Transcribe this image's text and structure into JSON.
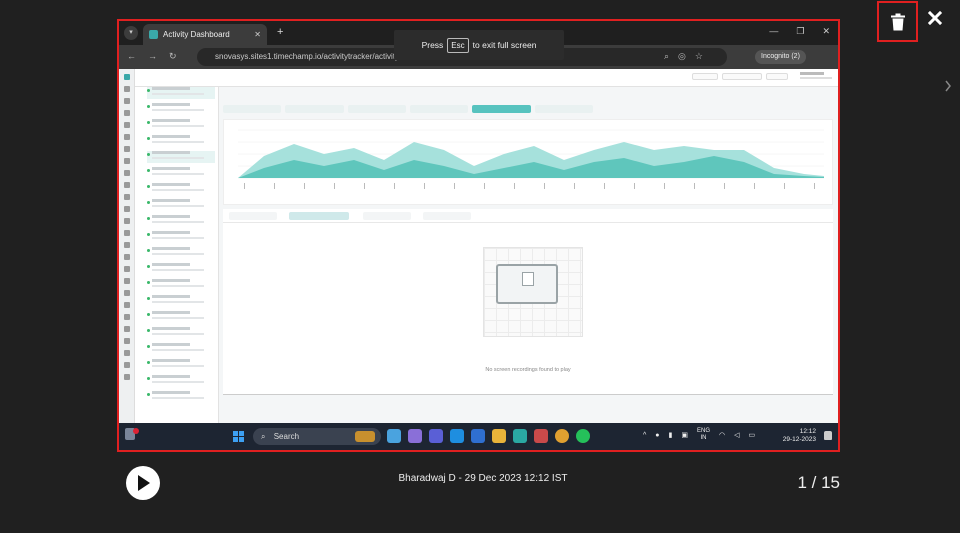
{
  "viewer": {
    "caption": "Bharadwaj D - 29 Dec 2023 12:12 IST",
    "counter": "1 / 15",
    "controls": {
      "delete_icon": "trash-icon",
      "close_icon": "close-icon",
      "next_icon": "chevron-right-icon",
      "play_icon": "play-icon"
    },
    "colors": {
      "highlight": "#e02020",
      "overlay": "#202020"
    }
  },
  "screenshot": {
    "browser": {
      "tab_title": "Activity Dashboard",
      "url": "snovasys.sites1.timechamp.io/activitytracker/activitydashboard/...=2023-12-29&tid=7b...",
      "incognito_label": "Incognito (2)",
      "fullscreen_notice": {
        "before": "Press",
        "key": "Esc",
        "after": "to exit full screen"
      }
    },
    "app": {
      "accent": "#3aa8a8",
      "empty_state_message": "No screen recordings found to play"
    },
    "taskbar": {
      "search_label": "Search",
      "lang_line1": "ENG",
      "lang_line2": "IN",
      "time": "12:12",
      "date": "29-12-2023"
    }
  }
}
